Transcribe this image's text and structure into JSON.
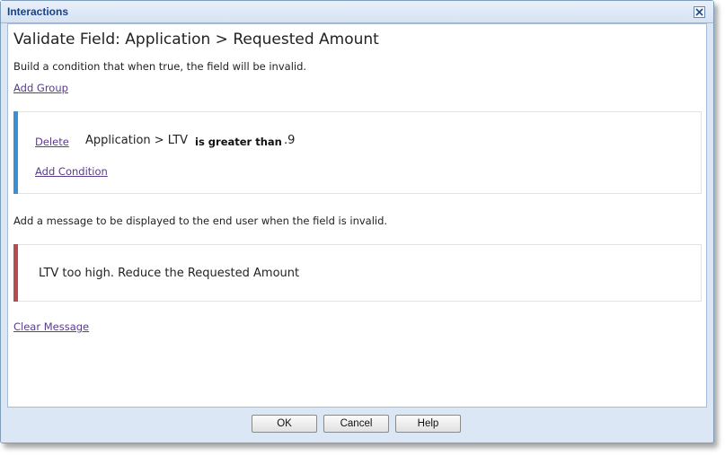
{
  "window": {
    "title": "Interactions",
    "close_icon": "close-icon"
  },
  "main": {
    "heading": "Validate Field: Application > Requested Amount",
    "condition_description": "Build a condition that when true, the field will be invalid.",
    "add_group_label": "Add Group",
    "condition_group": {
      "accent_color": "#3d8fd1",
      "delete_label": "Delete",
      "condition": {
        "field": "Application > LTV",
        "operator": "is greater than",
        "value": ".9"
      },
      "add_condition_label": "Add Condition"
    },
    "message_description": "Add a message to be displayed to the end user when the field is invalid.",
    "message": {
      "accent_color": "#b34d50",
      "text": "LTV too high. Reduce the Requested Amount"
    },
    "clear_message_label": "Clear Message"
  },
  "footer": {
    "ok_label": "OK",
    "cancel_label": "Cancel",
    "help_label": "Help"
  }
}
